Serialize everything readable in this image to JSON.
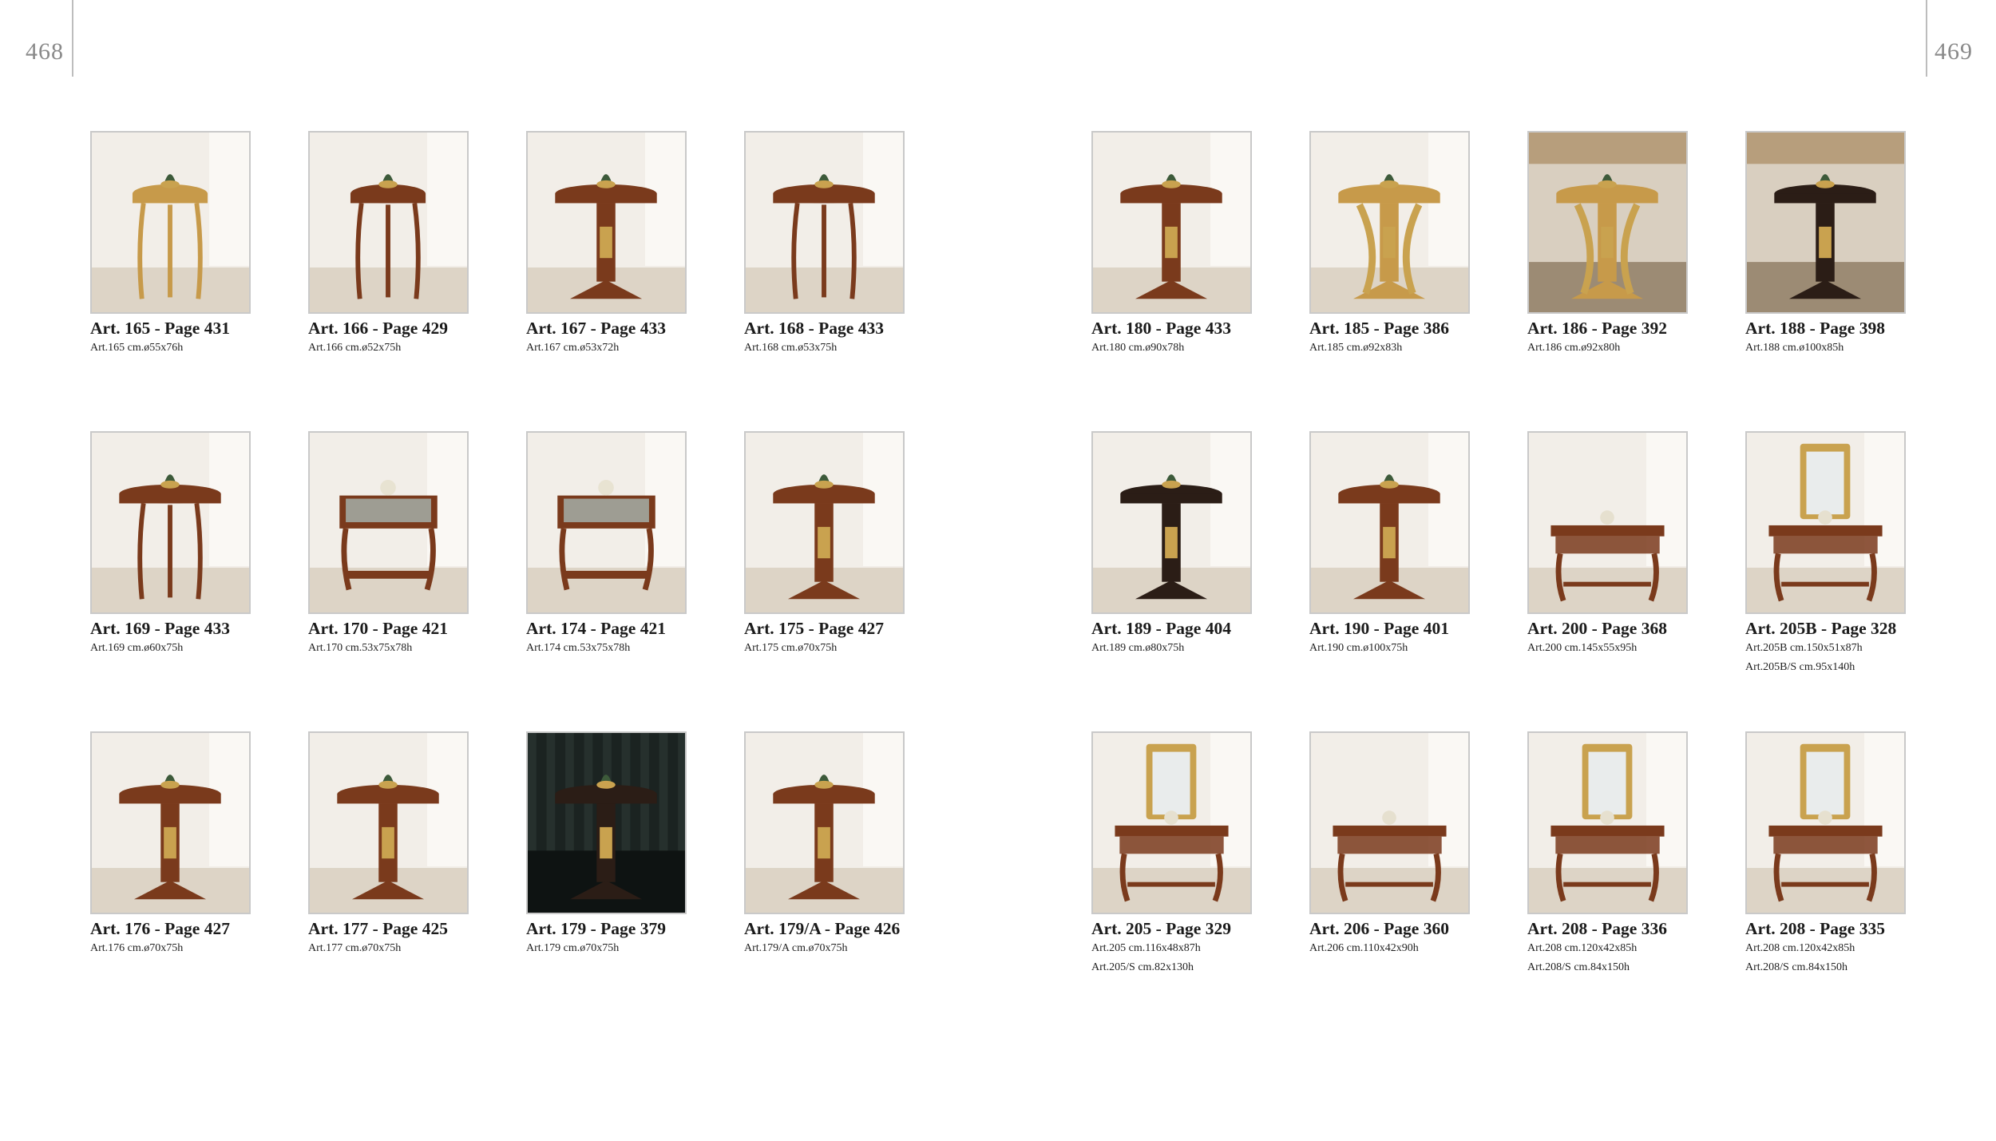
{
  "pages": {
    "left": "468",
    "right": "469"
  },
  "items": [
    {
      "title": "Art. 165 - Page 431",
      "dims": [
        "Art.165 cm.ø55x76h"
      ],
      "scene": "light",
      "table": "tall-gold"
    },
    {
      "title": "Art. 166 - Page 429",
      "dims": [
        "Art.166 cm.ø52x75h"
      ],
      "scene": "light",
      "table": "tall-walnut"
    },
    {
      "title": "Art. 167 - Page 433",
      "dims": [
        "Art.167 cm.ø53x72h"
      ],
      "scene": "light",
      "table": "pedestal-walnut"
    },
    {
      "title": "Art. 168 - Page 433",
      "dims": [
        "Art.168 cm.ø53x75h"
      ],
      "scene": "light",
      "table": "tripod-walnut"
    },
    {
      "title": "Art. 180 - Page 433",
      "dims": [
        "Art.180 cm.ø90x78h"
      ],
      "scene": "light",
      "table": "pedestal-walnut"
    },
    {
      "title": "Art. 185 - Page 386",
      "dims": [
        "Art.185 cm.ø92x83h"
      ],
      "scene": "light",
      "table": "gilt-carved"
    },
    {
      "title": "Art. 186 - Page 392",
      "dims": [
        "Art.186 cm.ø92x80h"
      ],
      "scene": "rich",
      "table": "gilt-carved"
    },
    {
      "title": "Art. 188 - Page 398",
      "dims": [
        "Art.188 cm.ø100x85h"
      ],
      "scene": "rich",
      "table": "pedestal-dark"
    },
    {
      "title": "Art. 169 - Page 433",
      "dims": [
        "Art.169 cm.ø60x75h"
      ],
      "scene": "light",
      "table": "tripod-walnut"
    },
    {
      "title": "Art. 170 - Page 421",
      "dims": [
        "Art.170 cm.53x75x78h"
      ],
      "scene": "light",
      "table": "vitrine"
    },
    {
      "title": "Art. 174 - Page 421",
      "dims": [
        "Art.174 cm.53x75x78h"
      ],
      "scene": "light",
      "table": "vitrine"
    },
    {
      "title": "Art. 175 - Page 427",
      "dims": [
        "Art.175 cm.ø70x75h"
      ],
      "scene": "light",
      "table": "pedestal-walnut"
    },
    {
      "title": "Art. 189 - Page 404",
      "dims": [
        "Art.189 cm.ø80x75h"
      ],
      "scene": "light",
      "table": "pedestal-dark"
    },
    {
      "title": "Art. 190 - Page 401",
      "dims": [
        "Art.190 cm.ø100x75h"
      ],
      "scene": "light",
      "table": "pedestal-walnut"
    },
    {
      "title": "Art. 200 - Page 368",
      "dims": [
        "Art.200 cm.145x55x95h"
      ],
      "scene": "light",
      "table": "console"
    },
    {
      "title": "Art. 205B - Page 328",
      "dims": [
        "Art.205B cm.150x51x87h",
        "Art.205B/S cm.95x140h"
      ],
      "scene": "light",
      "table": "console-mirror"
    },
    {
      "title": "Art. 176 - Page 427",
      "dims": [
        "Art.176 cm.ø70x75h"
      ],
      "scene": "light",
      "table": "pedestal-walnut"
    },
    {
      "title": "Art. 177 - Page 425",
      "dims": [
        "Art.177 cm.ø70x75h"
      ],
      "scene": "light",
      "table": "pedestal-walnut"
    },
    {
      "title": "Art. 179 - Page 379",
      "dims": [
        "Art.179 cm.ø70x75h"
      ],
      "scene": "dark",
      "table": "pedestal-dark"
    },
    {
      "title": "Art. 179/A - Page 426",
      "dims": [
        "Art.179/A cm.ø70x75h"
      ],
      "scene": "light",
      "table": "pedestal-walnut"
    },
    {
      "title": "Art. 205 - Page 329",
      "dims": [
        "Art.205 cm.116x48x87h",
        "Art.205/S cm.82x130h"
      ],
      "scene": "light",
      "table": "console-mirror"
    },
    {
      "title": "Art. 206 - Page 360",
      "dims": [
        "Art.206 cm.110x42x90h"
      ],
      "scene": "light",
      "table": "console"
    },
    {
      "title": "Art. 208 - Page 336",
      "dims": [
        "Art.208 cm.120x42x85h",
        "Art.208/S cm.84x150h"
      ],
      "scene": "light",
      "table": "console-mirror"
    },
    {
      "title": "Art. 208 - Page 335",
      "dims": [
        "Art.208 cm.120x42x85h",
        "Art.208/S cm.84x150h"
      ],
      "scene": "light",
      "table": "console-mirror"
    }
  ]
}
